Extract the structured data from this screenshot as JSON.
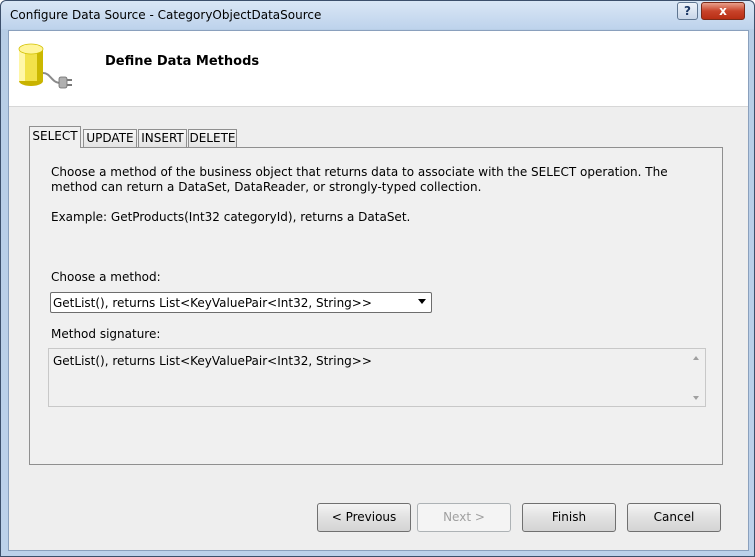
{
  "window": {
    "title": "Configure Data Source - CategoryObjectDataSource",
    "help_label": "?",
    "close_label": "x"
  },
  "header": {
    "title": "Define Data Methods",
    "icon": "database-plug-icon"
  },
  "tabs": [
    {
      "label": "SELECT",
      "active": true
    },
    {
      "label": "UPDATE",
      "active": false
    },
    {
      "label": "INSERT",
      "active": false
    },
    {
      "label": "DELETE",
      "active": false
    }
  ],
  "panel": {
    "description": "Choose a method of the business object that returns data to associate with the SELECT operation. The method can return a DataSet, DataReader, or strongly-typed collection.",
    "example": "Example: GetProducts(Int32 categoryId), returns a DataSet.",
    "choose_label": "Choose a method:",
    "method_selected": "GetList(), returns List<KeyValuePair<Int32, String>>",
    "signature_label": "Method signature:",
    "signature_value": "GetList(), returns List<KeyValuePair<Int32, String>>"
  },
  "buttons": {
    "previous": "< Previous",
    "next": "Next >",
    "finish": "Finish",
    "cancel": "Cancel"
  }
}
